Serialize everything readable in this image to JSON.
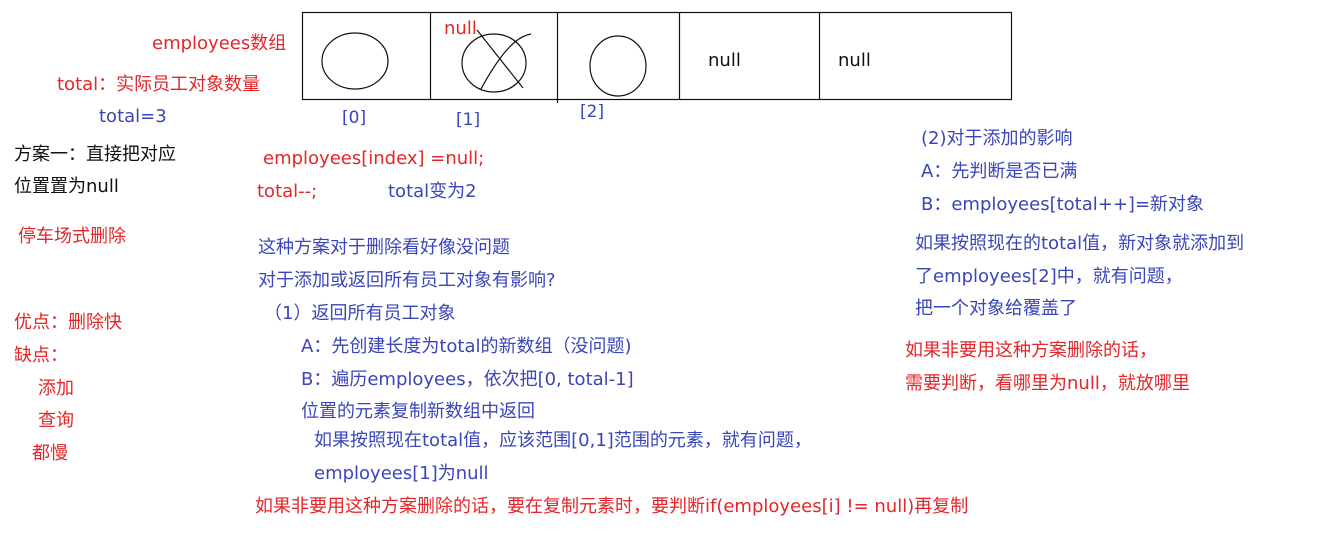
{
  "array_diagram": {
    "array_label": "employees数组",
    "cell_nulls": [
      "null",
      "null"
    ],
    "removed_null": "null",
    "indices": [
      "[0]",
      "[1]",
      "[2]"
    ]
  },
  "total_desc": "total：实际员工对象数量",
  "total_value": "total=3",
  "scheme1": [
    "方案一：直接把对应",
    "位置置为null"
  ],
  "parking_label": "停车场式删除",
  "pros": "优点：删除快",
  "cons_title": "缺点：",
  "cons": [
    "添加",
    "查询",
    "都慢"
  ],
  "code": {
    "line1": "employees[index] =null;",
    "line2": "total--;",
    "total_after": "total变为2"
  },
  "analysis": {
    "lines": [
      "这种方案对于删除看好像没问题",
      "对于添加或返回所有员工对象有影响?"
    ],
    "return_all": {
      "title": "（1）返回所有员工对象",
      "a": "A：先创建长度为total的新数组（没问题)",
      "b1": "B：遍历employees，依次把[0, total-1]",
      "b2": "位置的元素复制新数组中返回",
      "problem1": "如果按照现在total值，应该范围[0,1]范围的元素，就有问题，",
      "problem2": "employees[1]为null"
    },
    "conclusion": "如果非要用这种方案删除的话，要在复制元素时，要判断if(employees[i] != null)再复制"
  },
  "add_effect": {
    "title": "(2)对于添加的影响",
    "a": "A：先判断是否已满",
    "b": "B：employees[total++]=新对象",
    "problem": [
      "如果按照现在的total值，新对象就添加到",
      "了employees[2]中，就有问题，",
      "把一个对象给覆盖了"
    ],
    "conclusion": [
      "如果非要用这种方案删除的话，",
      "需要判断，看哪里为null，就放哪里"
    ]
  }
}
